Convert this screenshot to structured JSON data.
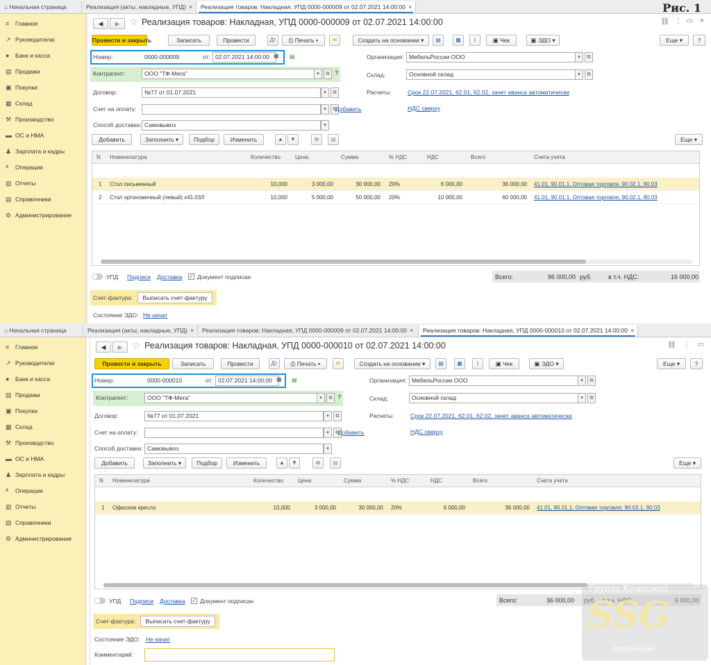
{
  "fig_label": "Рис. 1",
  "tabs_1": [
    {
      "label": "Начальная страница"
    },
    {
      "label": "Реализация (акты, накладные, УПД)"
    },
    {
      "label": "Реализация товаров: Накладная, УПД 0000-000009 от 02.07.2021 14:00:00"
    }
  ],
  "tabs_2": [
    {
      "label": "Начальная страница"
    },
    {
      "label": "Реализация (акты, накладные, УПД)"
    },
    {
      "label": "Реализация товаров: Накладная, УПД 0000-000009 от 02.07.2021 14:00:00"
    },
    {
      "label": "Реализация товаров: Накладная, УПД 0000-000010 от 02.07.2021 14:00:00"
    }
  ],
  "sidebar": [
    {
      "label": "Главное",
      "icon": "≡"
    },
    {
      "label": "Руководителю",
      "icon": "↗"
    },
    {
      "label": "Банк и касса",
      "icon": "●"
    },
    {
      "label": "Продажи",
      "icon": "▤"
    },
    {
      "label": "Покупки",
      "icon": "▣"
    },
    {
      "label": "Склад",
      "icon": "▦"
    },
    {
      "label": "Производство",
      "icon": "⚒"
    },
    {
      "label": "ОС и НМА",
      "icon": "▬"
    },
    {
      "label": "Зарплата и кадры",
      "icon": "♟"
    },
    {
      "label": "Операции",
      "icon": "ᴬ"
    },
    {
      "label": "Отчеты",
      "icon": "▥"
    },
    {
      "label": "Справочники",
      "icon": "▤"
    },
    {
      "label": "Администрирование",
      "icon": "⚙"
    }
  ],
  "toolbar": {
    "post_close": "Провести и закрыть",
    "save": "Записать",
    "post": "Провести",
    "print": "Печать",
    "create_based": "Создать на основании",
    "check": "Чек",
    "edo": "ЭДО",
    "more": "Еще",
    "help": "?"
  },
  "labels": {
    "number": "Номер:",
    "from": "от:",
    "contractor": "Контрагент:",
    "contract": "Договор:",
    "invoice_pay": "Счет на оплату:",
    "delivery": "Способ доставки:",
    "organization": "Организация:",
    "warehouse": "Склад:",
    "settlements": "Расчеты:",
    "add_link": "Добавить",
    "vat_on_top": "НДС сверху",
    "settle_link": "Срок 22.07.2021, 62.01, 62.02, зачет аванса автоматически"
  },
  "table_toolbar": {
    "add": "Добавить",
    "fill": "Заполнить",
    "select": "Подбор",
    "change": "Изменить",
    "more": "Еще"
  },
  "columns": [
    "N",
    "Номенклатура",
    "Количество",
    "Цена",
    "Сумма",
    "% НДС",
    "НДС",
    "Всего",
    "Счета учета"
  ],
  "footer": {
    "upd": "УПД",
    "signatures": "Подписи",
    "delivery": "Доставка",
    "signed": "Документ подписан",
    "total_label": "Всего:",
    "currency": "руб.",
    "vat_label": "в т.ч. НДС:",
    "invoice_label": "Счет-фактура:",
    "invoice_btn": "Выписать счет-фактуру",
    "edo_state_label": "Состояние ЭДО:",
    "edo_state": "Не начат",
    "comment_label": "Комментарий:"
  },
  "doc1": {
    "title": "Реализация товаров: Накладная, УПД 0000-000009 от 02.07.2021 14:00:00",
    "number": "0000-000009",
    "date": "02.07.2021 14:00:00",
    "contractor": "ООО \"ТФ-Мега\"",
    "contract": "№77 от 01.07.2021",
    "invoice_pay": "",
    "delivery": "Самовывоз",
    "organization": "МебельРоссии ООО",
    "warehouse": "Основной склад",
    "rows": [
      {
        "n": "1",
        "name": "Стол письменный",
        "qty": "10,000",
        "price": "3 000,00",
        "sum": "30 000,00",
        "vat_rate": "20%",
        "vat": "6 000,00",
        "total": "36 000,00",
        "accounts": "41.01, 90.01.1, Оптовая торговля, 90.02.1, 90.03"
      },
      {
        "n": "2",
        "name": "Стол эргономичный (левый) x41.03Л",
        "qty": "10,000",
        "price": "5 000,00",
        "sum": "50 000,00",
        "vat_rate": "20%",
        "vat": "10 000,00",
        "total": "60 000,00",
        "accounts": "41.01, 90.01.1, Оптовая торговля, 90.02.1, 90.03"
      }
    ],
    "total": "96 000,00",
    "vat_total": "16 000,00"
  },
  "doc2": {
    "title": "Реализация товаров: Накладная, УПД 0000-000010 от 02.07.2021 14:00:00",
    "number": "0000-000010",
    "date": "02.07.2021 14:00:00",
    "contractor": "ООО \"ТФ-Мега\"",
    "contract": "№77 от 01.07.2021",
    "invoice_pay": "",
    "delivery": "Самовывоз",
    "organization": "МебельРоссии ООО",
    "warehouse": "Основной склад",
    "rows": [
      {
        "n": "1",
        "name": "Офисное кресло",
        "qty": "10,000",
        "price": "3 000,00",
        "sum": "30 000,00",
        "vat_rate": "20%",
        "vat": "6 000,00",
        "total": "36 000,00",
        "accounts": "41.01, 90.01.1, Оптовая торговля, 90.02.1, 90.03"
      }
    ],
    "total": "36 000,00",
    "vat_total": "6 000,00",
    "comment": ""
  },
  "watermark": {
    "line1": "Группа Компаний",
    "logo": "SSG",
    "line2": "SoftServisGold"
  },
  "colors": {
    "accent": "#1a8fd0",
    "yellow_button": "#f8d200",
    "sidebar_bg": "#fbf0b7",
    "link": "#1a52a3"
  }
}
